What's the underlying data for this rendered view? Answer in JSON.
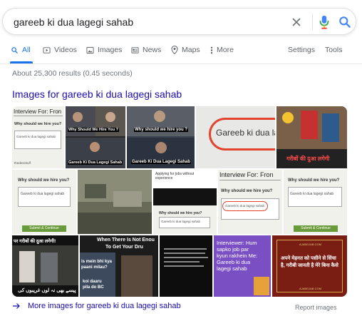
{
  "search": {
    "query": "gareeb ki dua lagegi sahab"
  },
  "tabs": [
    {
      "label": "All",
      "icon": "search-icon",
      "active": true
    },
    {
      "label": "Videos",
      "icon": "video-icon"
    },
    {
      "label": "Images",
      "icon": "image-icon"
    },
    {
      "label": "News",
      "icon": "news-icon"
    },
    {
      "label": "Maps",
      "icon": "map-pin-icon"
    },
    {
      "label": "More",
      "icon": "more-vertical-icon"
    },
    {
      "label": "Settings"
    },
    {
      "label": "Tools"
    }
  ],
  "results": {
    "stats": "About 25,300 results (0.45 seconds)"
  },
  "images_section": {
    "heading": "Images for gareeb ki dua lagegi sahab",
    "more_link": "More images for gareeb ki dua lagegi sahab",
    "report": "Report images"
  },
  "thumbs": {
    "t1_title": "Interview For: Fron",
    "t1_q": "Why should we hire you?",
    "t1_ans": "Gareeb ki dua lagegi sahab",
    "t1_src": "thedesistuff",
    "t2_cap1": "Why Should We Hire You ?",
    "t2_cap2": "Gareeb Ki Dua Lagegi Sahab",
    "t3_cap1": "Why should we hire you ?",
    "t3_cap2": "Gareeb Ki Dua Lagegi Sahab",
    "t4_text": "Gareeb ki dua la",
    "t5_cap": "गरीबों की दुआ लगेगी",
    "t6_q": "Why should we hire you?",
    "t6_ans": "Gareeb ki dua lagegi sahab",
    "t6_btn": "Submit & Continue",
    "t8_head": "Applying for jobs without experience",
    "t8_q": "Why should we hire you?",
    "t8_ans": "Gareeb ki dua lagegi sahab",
    "t9_title": "Interview For: Fron",
    "t9_q": "Why should we hire you?",
    "t9_ans": "Gareeb ki dua lagegi sahab",
    "t10_q": "Why should we hire you?",
    "t10_ans": "Gareeb ki dua lagegi sahab",
    "t10_btn": "Submit & Continue",
    "t11_top": "पर गरीबों की दुआ लगेगी!",
    "t11_bot": "پیسے بھی نہ لوں غریبوں کی",
    "t12_cap1": "When There Is Not Enou",
    "t12_cap2": "To Get Your Dru",
    "t12_cap3": "is mein bhi kya",
    "t12_cap4": "paani milau?",
    "t12_cap5": "koi daaru",
    "t12_cap6": "pila do BC",
    "t14_text": "Interviewer: Hum sapko job par kyun rakhein Me: Gareeb ki dua lagegi sahab",
    "t15_site": "AJABGJAB.COM",
    "t15_text": "अपने मेहनत को पसीने से सिंचा है, गरीबी जानती है मेरे बिना कैसे",
    "t15_site2": "AJABGJAB.COM"
  }
}
